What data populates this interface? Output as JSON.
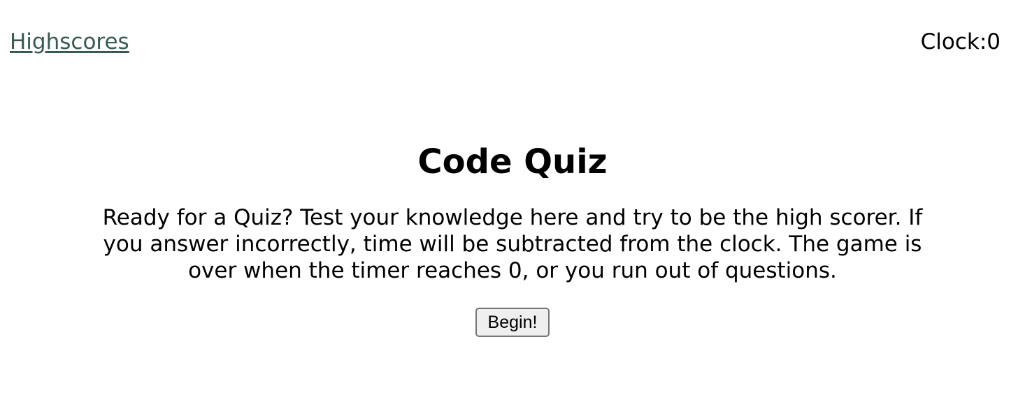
{
  "nav": {
    "highscores_label": "Highscores"
  },
  "clock": {
    "label": "Clock: ",
    "value": "0"
  },
  "main": {
    "title": "Code Quiz",
    "intro": "Ready for a Quiz? Test your knowledge here and try to be the high scorer. If you answer incorrectly, time will be subtracted from the clock. The game is over when the timer reaches 0, or you run out of questions.",
    "begin_label": "Begin!"
  },
  "colors": {
    "link": "#375a52",
    "text": "#000000",
    "background": "#ffffff",
    "button_bg": "#efefef",
    "button_border": "#767676"
  }
}
